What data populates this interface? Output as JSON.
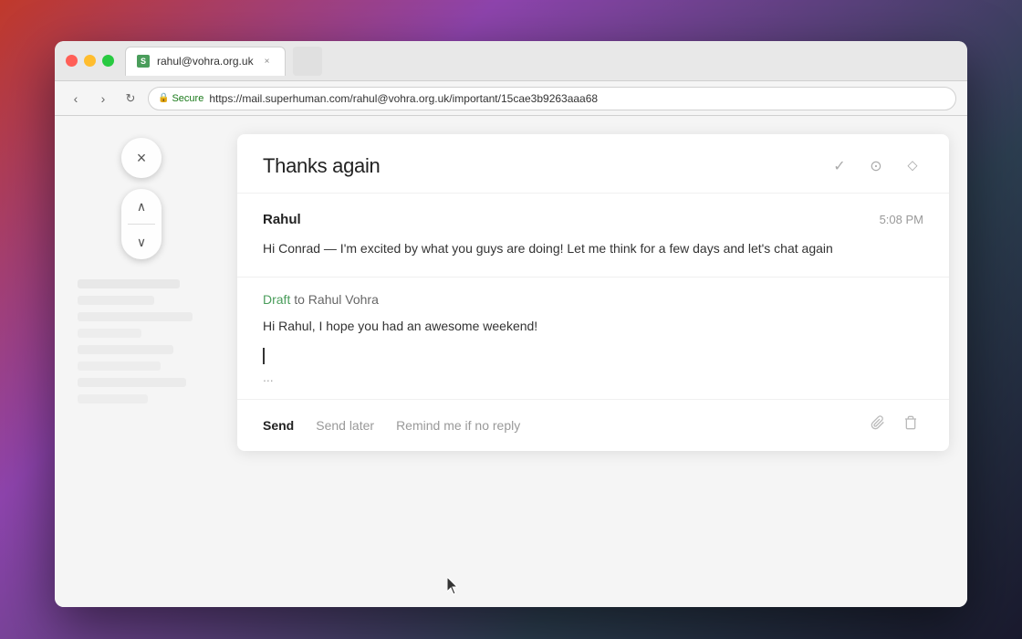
{
  "desktop": {
    "background": "gradient"
  },
  "browser": {
    "tab": {
      "favicon_label": "S",
      "title": "rahul@vohra.org.uk",
      "close_label": "×"
    },
    "toolbar": {
      "back_label": "‹",
      "forward_label": "›",
      "reload_label": "↻",
      "secure_label": "Secure",
      "url": "https://mail.superhuman.com/rahul@vohra.org.uk/important/15cae3b9263aaa68"
    }
  },
  "email": {
    "subject": "Thanks again",
    "header_actions": {
      "check_label": "✓",
      "clock_label": "⏱",
      "shield_label": "🛡"
    },
    "message": {
      "sender": "Rahul",
      "time": "5:08 PM",
      "body": "Hi Conrad — I'm excited by what you guys are doing!  Let me think for a few days and let's chat again"
    },
    "draft": {
      "label_green": "Draft",
      "label_gray": " to Rahul Vohra",
      "body_line1": "Hi Rahul, I hope you had an awesome weekend!",
      "ellipsis": "..."
    },
    "toolbar": {
      "send_label": "Send",
      "send_later_label": "Send later",
      "remind_label": "Remind me if no reply",
      "attach_icon": "📎",
      "delete_icon": "🗑"
    }
  },
  "sidebar": {
    "close_label": "×",
    "up_label": "∧",
    "down_label": "∨"
  }
}
